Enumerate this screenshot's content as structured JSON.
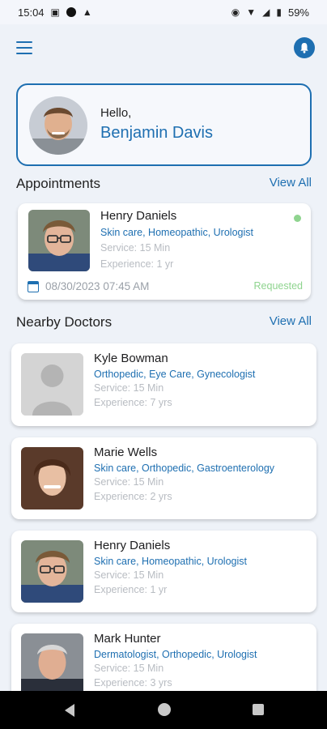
{
  "status_bar": {
    "time": "15:04",
    "battery": "59%",
    "left_icons": [
      "image-icon",
      "circle-icon",
      "warning-icon"
    ],
    "right_icons": [
      "eye-icon",
      "wifi-icon",
      "signal-icon",
      "battery-icon"
    ]
  },
  "header": {
    "menu_icon": "hamburger-menu-icon",
    "profile_icon": "user-circle-icon",
    "accent_color": "#1e6fb1"
  },
  "greeting": {
    "hello": "Hello,",
    "name": "Benjamin Davis"
  },
  "appointments": {
    "title": "Appointments",
    "view_all": "View All",
    "items": [
      {
        "name": "Henry Daniels",
        "specialties": "Skin care, Homeopathic, Urologist",
        "service": "Service: 15 Min",
        "experience": "Experience: 1 yr",
        "date": "08/30/2023 07:45 AM",
        "status": "Requested",
        "status_color": "#8fd48f"
      }
    ]
  },
  "nearby": {
    "title": "Nearby Doctors",
    "view_all": "View All",
    "doctors": [
      {
        "name": "Kyle Bowman",
        "specialties": "Orthopedic, Eye Care, Gynecologist",
        "service": "Service: 15 Min",
        "experience": "Experience: 7 yrs",
        "photo": "placeholder"
      },
      {
        "name": "Marie Wells",
        "specialties": "Skin care, Orthopedic, Gastroenterology",
        "service": "Service: 15 Min",
        "experience": "Experience: 2 yrs",
        "photo": "woman"
      },
      {
        "name": "Henry Daniels",
        "specialties": "Skin care, Homeopathic, Urologist",
        "service": "Service: 15 Min",
        "experience": "Experience: 1 yr",
        "photo": "man-glasses"
      },
      {
        "name": "Mark Hunter",
        "specialties": "Dermatologist, Orthopedic, Urologist",
        "service": "Service: 15 Min",
        "experience": "Experience: 3 yrs",
        "photo": "older-man"
      }
    ]
  },
  "nav_bar": {
    "back_icon": "back-triangle-icon",
    "home_icon": "home-circle-icon",
    "recents_icon": "recents-square-icon"
  }
}
